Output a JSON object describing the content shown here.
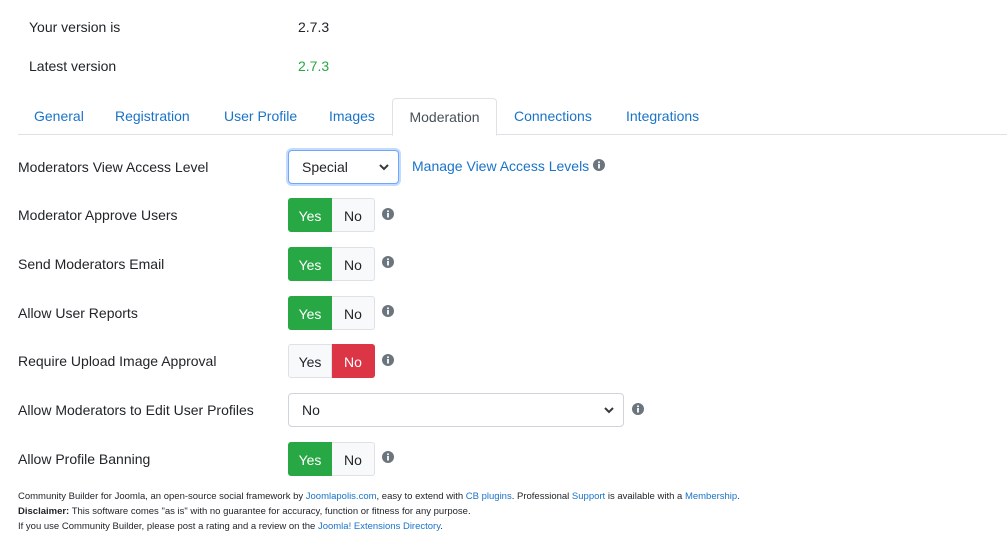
{
  "version": {
    "your_label": "Your version is",
    "your_value": "2.7.3",
    "latest_label": "Latest version",
    "latest_value": "2.7.3"
  },
  "tabs": [
    {
      "label": "General"
    },
    {
      "label": "Registration"
    },
    {
      "label": "User Profile"
    },
    {
      "label": "Images"
    },
    {
      "label": "Moderation"
    },
    {
      "label": "Connections"
    },
    {
      "label": "Integrations"
    }
  ],
  "active_tab": "Moderation",
  "settings": {
    "view_access": {
      "label": "Moderators View Access Level",
      "value": "Special",
      "link": "Manage View Access Levels"
    },
    "approve_users": {
      "label": "Moderator Approve Users",
      "yes": "Yes",
      "no": "No",
      "selected": "Yes"
    },
    "send_email": {
      "label": "Send Moderators Email",
      "yes": "Yes",
      "no": "No",
      "selected": "Yes"
    },
    "user_reports": {
      "label": "Allow User Reports",
      "yes": "Yes",
      "no": "No",
      "selected": "Yes"
    },
    "upload_approval": {
      "label": "Require Upload Image Approval",
      "yes": "Yes",
      "no": "No",
      "selected": "No"
    },
    "edit_profiles": {
      "label": "Allow Moderators to Edit User Profiles",
      "value": "No"
    },
    "profile_banning": {
      "label": "Allow Profile Banning",
      "yes": "Yes",
      "no": "No",
      "selected": "Yes"
    }
  },
  "footer": {
    "line1_a": "Community Builder for Joomla, an open-source social framework by ",
    "line1_link1": "Joomlapolis.com",
    "line1_b": ", easy to extend with ",
    "line1_link2": "CB plugins",
    "line1_c": ". Professional ",
    "line1_link3": "Support",
    "line1_d": " is available with a ",
    "line1_link4": "Membership",
    "line1_e": ".",
    "line2_bold": "Disclaimer:",
    "line2_text": " This software comes \"as is\" with no guarantee for accuracy, function or fitness for any purpose.",
    "line3_a": "If you use Community Builder, please post a rating and a review on the ",
    "line3_link": "Joomla! Extensions Directory",
    "line3_b": "."
  },
  "colors": {
    "link": "#1a73c8",
    "yes_active": "#28a745",
    "no_active": "#dc3545",
    "latest_version": "#28a745"
  }
}
